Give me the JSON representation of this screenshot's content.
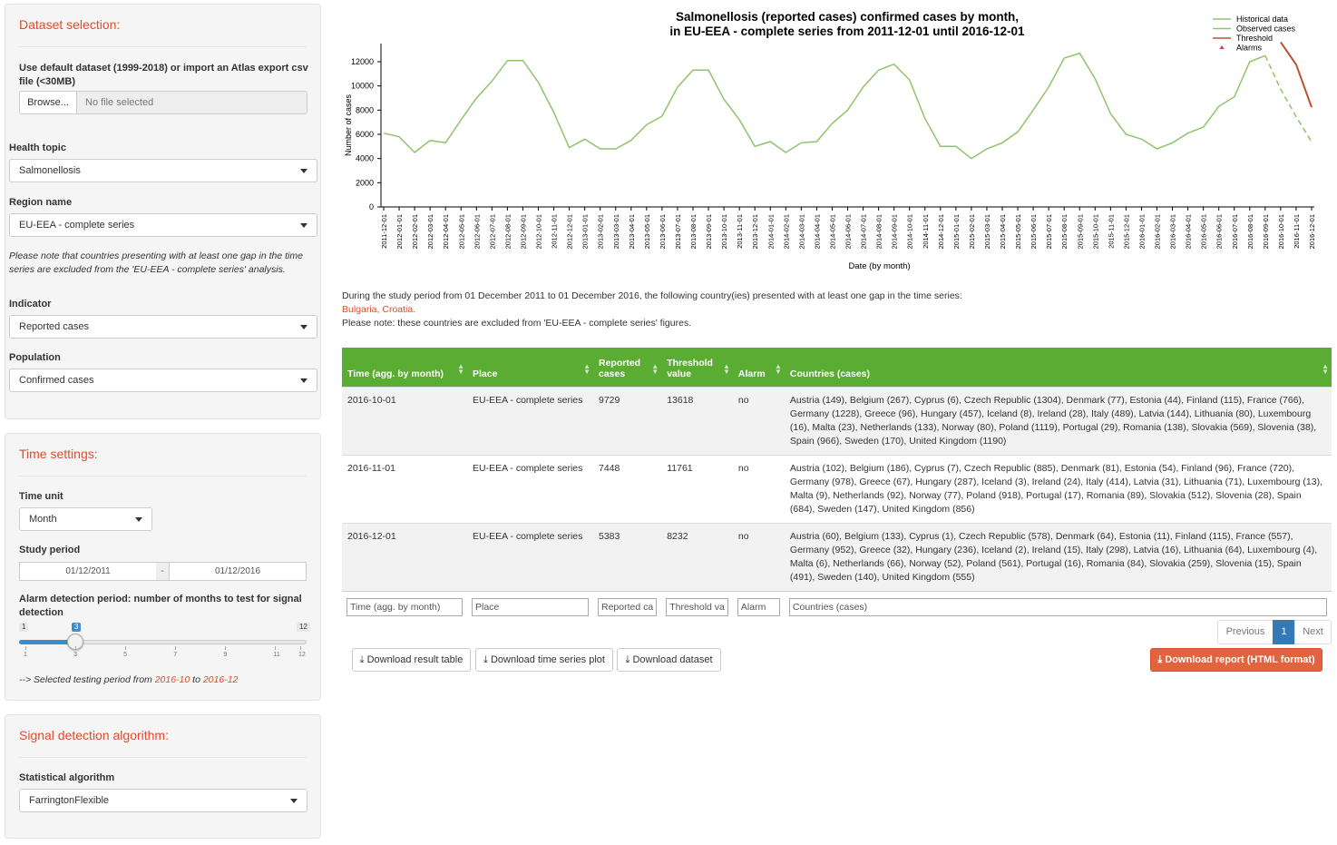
{
  "sidebar": {
    "dataset": {
      "title": "Dataset selection:",
      "import_label": "Use default dataset (1999-2018) or import an Atlas export csv file (<30MB)",
      "browse_label": "Browse...",
      "file_placeholder": "No file selected",
      "health_topic_label": "Health topic",
      "health_topic_value": "Salmonellosis",
      "region_label": "Region name",
      "region_value": "EU-EEA - complete series",
      "region_note": "Please note that countries presenting with at least one gap in the time series are excluded from the 'EU-EEA - complete series' analysis.",
      "indicator_label": "Indicator",
      "indicator_value": "Reported cases",
      "population_label": "Population",
      "population_value": "Confirmed cases"
    },
    "time": {
      "title": "Time settings:",
      "time_unit_label": "Time unit",
      "time_unit_value": "Month",
      "study_period_label": "Study period",
      "study_start": "01/12/2011",
      "study_sep": "-",
      "study_end": "01/12/2016",
      "alarm_label": "Alarm detection period: number of months to test for signal detection",
      "slider_min": "1",
      "slider_max": "12",
      "slider_value": "3",
      "slider_ticks": [
        "1",
        "3",
        "5",
        "7",
        "9",
        "11",
        "12"
      ],
      "selected_prefix": "--> Selected testing period from ",
      "selected_from": "2016-10",
      "selected_mid": " to ",
      "selected_to": "2016-12"
    },
    "algorithm": {
      "title": "Signal detection algorithm:",
      "label": "Statistical algorithm",
      "value": "FarringtonFlexible"
    }
  },
  "chart_data": {
    "type": "line",
    "title_line1": "Salmonellosis (reported cases) confirmed cases by month,",
    "title_line2": "in EU-EEA - complete series from 2011-12-01 until 2016-12-01",
    "xlabel": "Date (by month)",
    "ylabel": "Number of cases",
    "ylim": [
      0,
      13500
    ],
    "yticks": [
      0,
      2000,
      4000,
      6000,
      8000,
      10000,
      12000
    ],
    "legend_position": "top-right",
    "legend": [
      "Historical data",
      "Observed cases",
      "Threshold",
      "Alarms"
    ],
    "colors": {
      "historical": "#8fc46a",
      "observed": "#8fc46a",
      "threshold": "#c0502a",
      "alarm": "#e03030"
    },
    "x": [
      "2011-12-01",
      "2012-01-01",
      "2012-02-01",
      "2012-03-01",
      "2012-04-01",
      "2012-05-01",
      "2012-06-01",
      "2012-07-01",
      "2012-08-01",
      "2012-09-01",
      "2012-10-01",
      "2012-11-01",
      "2012-12-01",
      "2013-01-01",
      "2013-02-01",
      "2013-03-01",
      "2013-04-01",
      "2013-05-01",
      "2013-06-01",
      "2013-07-01",
      "2013-08-01",
      "2013-09-01",
      "2013-10-01",
      "2013-11-01",
      "2013-12-01",
      "2014-01-01",
      "2014-02-01",
      "2014-03-01",
      "2014-04-01",
      "2014-05-01",
      "2014-06-01",
      "2014-07-01",
      "2014-08-01",
      "2014-09-01",
      "2014-10-01",
      "2014-11-01",
      "2014-12-01",
      "2015-01-01",
      "2015-02-01",
      "2015-03-01",
      "2015-04-01",
      "2015-05-01",
      "2015-06-01",
      "2015-07-01",
      "2015-08-01",
      "2015-09-01",
      "2015-10-01",
      "2015-11-01",
      "2015-12-01",
      "2016-01-01",
      "2016-02-01",
      "2016-03-01",
      "2016-04-01",
      "2016-05-01",
      "2016-06-01",
      "2016-07-01",
      "2016-08-01",
      "2016-09-01",
      "2016-10-01",
      "2016-11-01",
      "2016-12-01"
    ],
    "series": [
      {
        "name": "Historical data",
        "values": [
          6100,
          5800,
          4500,
          5500,
          5300,
          7200,
          9000,
          10400,
          12100,
          12100,
          10300,
          7800,
          4900,
          5600,
          4800,
          4800,
          5500,
          6800,
          7500,
          9900,
          11300,
          11300,
          8900,
          7200,
          5000,
          5400,
          4500,
          5300,
          5400,
          6900,
          8000,
          9900,
          11300,
          11800,
          10500,
          7300,
          5000,
          5000,
          4000,
          4800,
          5300,
          6200,
          8000,
          9900,
          12300,
          12700,
          10600,
          7700,
          6000,
          5600,
          4800,
          5300,
          6100,
          6600,
          8300,
          9100,
          12000,
          12500,
          null,
          null,
          null
        ]
      },
      {
        "name": "Observed cases",
        "values": [
          null,
          null,
          null,
          null,
          null,
          null,
          null,
          null,
          null,
          null,
          null,
          null,
          null,
          null,
          null,
          null,
          null,
          null,
          null,
          null,
          null,
          null,
          null,
          null,
          null,
          null,
          null,
          null,
          null,
          null,
          null,
          null,
          null,
          null,
          null,
          null,
          null,
          null,
          null,
          null,
          null,
          null,
          null,
          null,
          null,
          null,
          null,
          null,
          null,
          null,
          null,
          null,
          null,
          null,
          null,
          null,
          null,
          12500,
          9729,
          7448,
          5383
        ]
      },
      {
        "name": "Threshold",
        "values": [
          null,
          null,
          null,
          null,
          null,
          null,
          null,
          null,
          null,
          null,
          null,
          null,
          null,
          null,
          null,
          null,
          null,
          null,
          null,
          null,
          null,
          null,
          null,
          null,
          null,
          null,
          null,
          null,
          null,
          null,
          null,
          null,
          null,
          null,
          null,
          null,
          null,
          null,
          null,
          null,
          null,
          null,
          null,
          null,
          null,
          null,
          null,
          null,
          null,
          null,
          null,
          null,
          null,
          null,
          null,
          null,
          null,
          null,
          13618,
          11761,
          8232
        ]
      }
    ]
  },
  "info": {
    "line1": "During the study period from 01 December 2011 to 01 December 2016, the following country(ies) presented with at least one gap in the time series:",
    "countries": "Bulgaria, Croatia.",
    "line3": "Please note: these countries are excluded from 'EU-EEA - complete series' figures."
  },
  "table": {
    "headers": [
      "Time (agg. by month)",
      "Place",
      "Reported cases",
      "Threshold value",
      "Alarm",
      "Countries (cases)"
    ],
    "rows": [
      [
        "2016-10-01",
        "EU-EEA - complete series",
        "9729",
        "13618",
        "no",
        "Austria (149), Belgium (267), Cyprus (6), Czech Republic (1304), Denmark (77), Estonia (44), Finland (115), France (766), Germany (1228), Greece (96), Hungary (457), Iceland (8), Ireland (28), Italy (489), Latvia (144), Lithuania (80), Luxembourg (16), Malta (23), Netherlands (133), Norway (80), Poland (1119), Portugal (29), Romania (138), Slovakia (569), Slovenia (38), Spain (966), Sweden (170), United Kingdom (1190)"
      ],
      [
        "2016-11-01",
        "EU-EEA - complete series",
        "7448",
        "11761",
        "no",
        "Austria (102), Belgium (186), Cyprus (7), Czech Republic (885), Denmark (81), Estonia (54), Finland (96), France (720), Germany (978), Greece (67), Hungary (287), Iceland (3), Ireland (24), Italy (414), Latvia (31), Lithuania (71), Luxembourg (13), Malta (9), Netherlands (92), Norway (77), Poland (918), Portugal (17), Romania (89), Slovakia (512), Slovenia (28), Spain (684), Sweden (147), United Kingdom (856)"
      ],
      [
        "2016-12-01",
        "EU-EEA - complete series",
        "5383",
        "8232",
        "no",
        "Austria (60), Belgium (133), Cyprus (1), Czech Republic (578), Denmark (64), Estonia (11), Finland (115), France (557), Germany (952), Greece (32), Hungary (236), Iceland (2), Ireland (15), Italy (298), Latvia (16), Lithuania (64), Luxembourg (4), Malta (6), Netherlands (66), Norway (52), Poland (561), Portugal (16), Romania (84), Slovakia (259), Slovenia (15), Spain (491), Sweden (140), United Kingdom (555)"
      ]
    ],
    "filters": [
      "Time (agg. by month)",
      "Place",
      "Reported ca",
      "Threshold va",
      "Alarm",
      "Countries (cases)"
    ]
  },
  "pagination": {
    "previous": "Previous",
    "current": "1",
    "next": "Next"
  },
  "buttons": {
    "download_table": "Download result table",
    "download_plot": "Download time series plot",
    "download_dataset": "Download dataset",
    "download_report": "Download report (HTML format)"
  }
}
